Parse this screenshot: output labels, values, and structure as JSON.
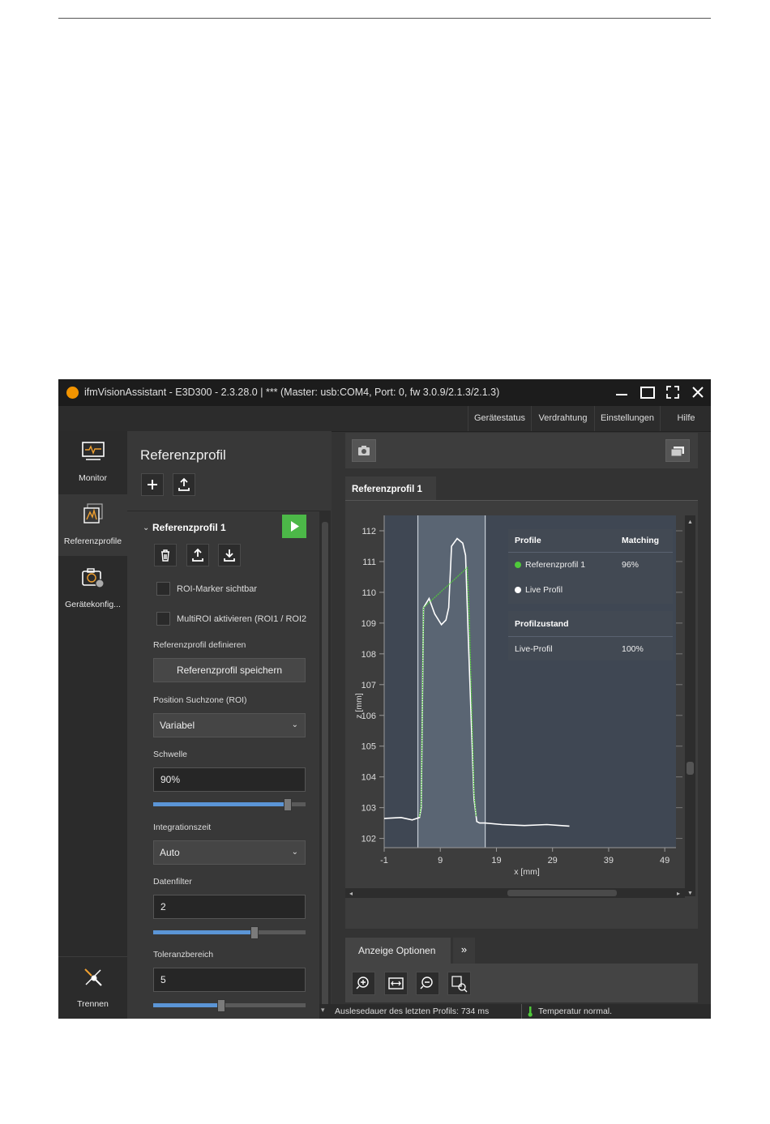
{
  "window": {
    "title": "ifmVisionAssistant - E3D300 - 2.3.28.0 | *** (Master: usb:COM4, Port: 0, fw 3.0.9/2.1.3/2.1.3)",
    "controls": [
      "minimize",
      "maximize",
      "fullscreen",
      "close"
    ]
  },
  "menu": {
    "items": [
      "Gerätestatus",
      "Verdrahtung",
      "Einstellungen",
      "Hilfe"
    ]
  },
  "nav": {
    "monitor": "Monitor",
    "referenzprofile": "Referenzprofile",
    "geraetekonfig": "Gerätekonfig...",
    "trennen": "Trennen"
  },
  "panel": {
    "heading": "Referenzprofil",
    "item_title": "Referenzprofil 1",
    "roi_marker_label": "ROI-Marker sichtbar",
    "multiroi_label": "MultiROI aktivieren (ROI1 / ROI2",
    "define_label": "Referenzprofil definieren",
    "save_button": "Referenzprofil speichern",
    "position_label": "Position Suchzone (ROI)",
    "position_value": "Variabel",
    "schwelle_label": "Schwelle",
    "schwelle_value": "90%",
    "schwelle_level": 0.88,
    "integration_label": "Integrationszeit",
    "integration_value": "Auto",
    "datenfilter_label": "Datenfilter",
    "datenfilter_value": "2",
    "datenfilter_level": 0.66,
    "toleranz_label": "Toleranzbereich",
    "toleranz_value": "5",
    "toleranz_level": 0.44
  },
  "view": {
    "tab_label": "Referenzprofil 1",
    "options_tab": "Anzeige Optionen"
  },
  "overlay": {
    "col_profile": "Profile",
    "col_matching": "Matching",
    "ref_name": "Referenzprofil 1",
    "ref_match": "96%",
    "live_name": "Live Profil",
    "state_header": "Profilzustand",
    "state_name": "Live-Profil",
    "state_value": "100%",
    "ref_color": "#4fc93a",
    "live_color": "#ffffff"
  },
  "status": {
    "readout": "Auslesedauer des letzten Profils: 734 ms",
    "temperature": "Temperatur normal."
  },
  "chart_data": {
    "type": "line",
    "xlabel": "x [mm]",
    "ylabel": "z [mm]",
    "x_ticks": [
      -1,
      9,
      19,
      29,
      39,
      49
    ],
    "y_ticks": [
      102,
      103,
      104,
      105,
      106,
      107,
      108,
      109,
      110,
      111,
      112
    ],
    "xlim": [
      -1,
      51
    ],
    "ylim": [
      101.7,
      112.5
    ],
    "roi_x": [
      5,
      17
    ],
    "series": [
      {
        "color": "#ffffff",
        "x": [
          -1,
          2,
          4,
          5.3,
          5.6,
          6,
          7,
          8,
          9.2,
          10,
          10.5,
          11,
          12,
          13,
          13.5,
          14,
          15,
          15.5,
          16,
          17,
          20,
          24,
          28,
          32
        ],
        "y": [
          102.65,
          102.68,
          102.6,
          102.68,
          103,
          109.5,
          109.8,
          109.3,
          108.95,
          109.1,
          109.5,
          111.5,
          111.75,
          111.6,
          111.2,
          108.5,
          103.3,
          102.55,
          102.5,
          102.5,
          102.45,
          102.42,
          102.45,
          102.4
        ]
      },
      {
        "color": "#4fc93a",
        "x": [
          5.3,
          5.6,
          6,
          13.8,
          14.2,
          15,
          15.4
        ],
        "y": [
          102.7,
          103.1,
          109.5,
          110.8,
          109,
          103.5,
          102.7
        ]
      }
    ]
  }
}
